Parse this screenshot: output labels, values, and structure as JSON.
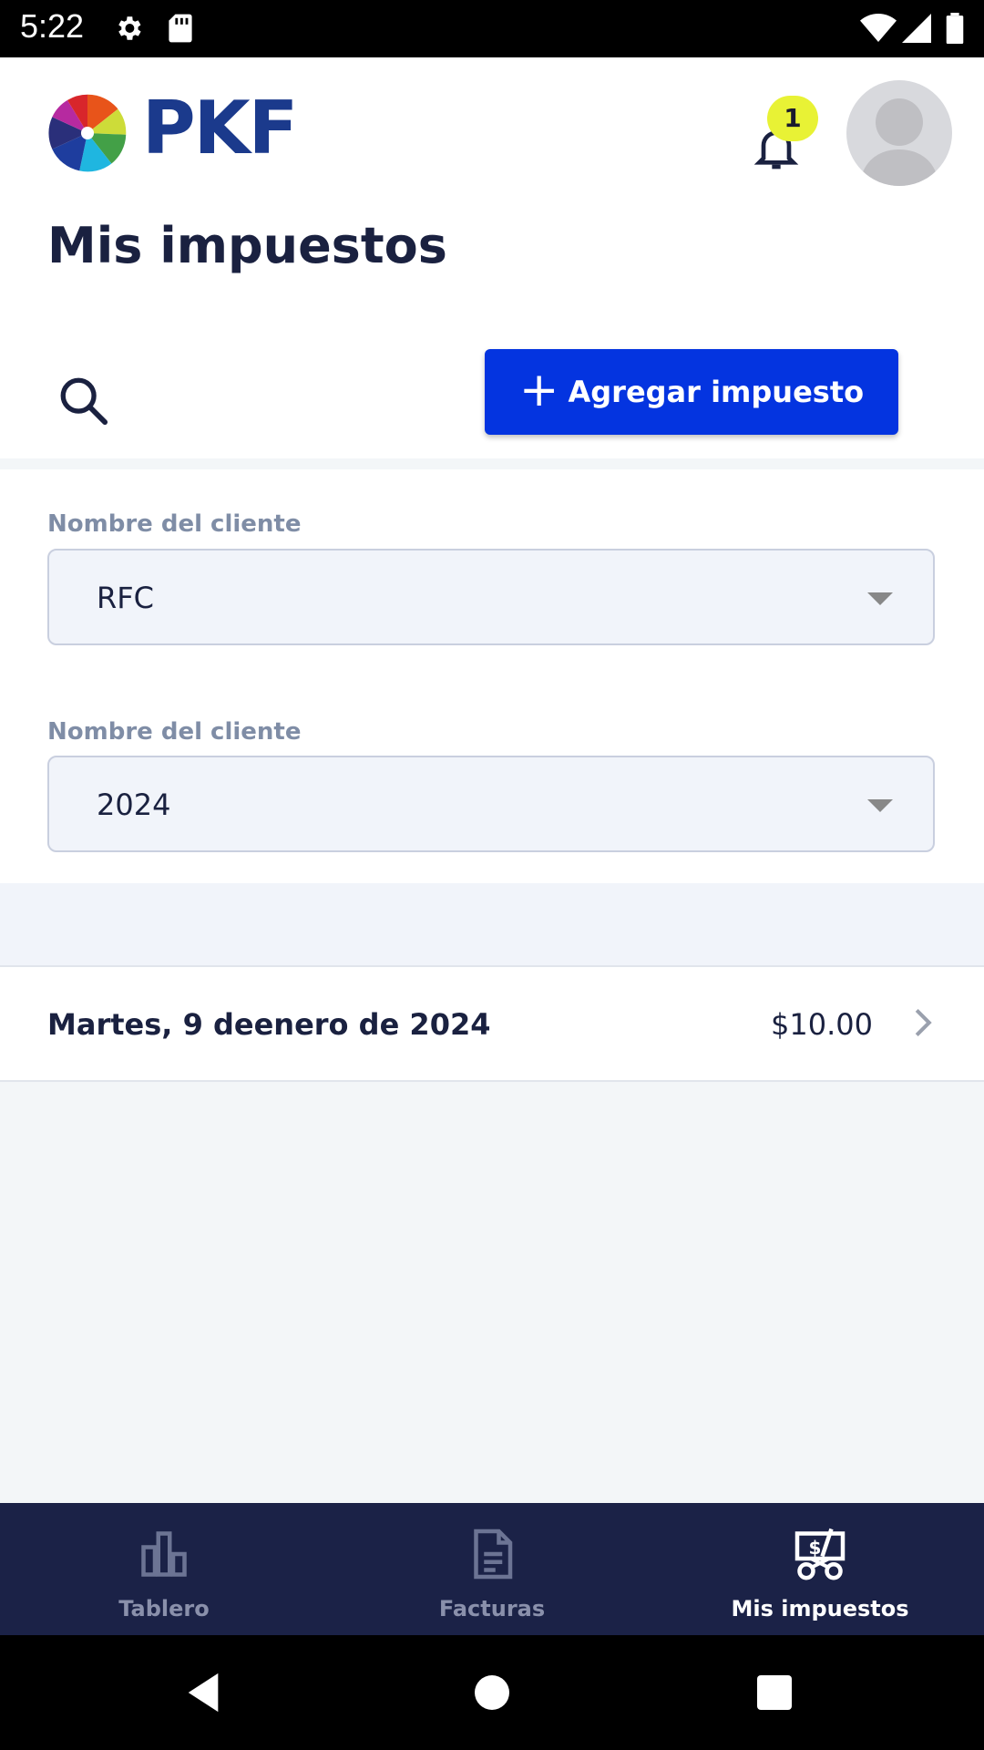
{
  "status_bar": {
    "time": "5:22"
  },
  "header": {
    "logo_text": "PKF",
    "notification_count": "1",
    "page_title": "Mis impuestos"
  },
  "toolbar": {
    "add_label": "Agregar impuesto"
  },
  "filters": [
    {
      "label": "Nombre del cliente",
      "value": "RFC"
    },
    {
      "label": "Nombre del cliente",
      "value": "2024"
    }
  ],
  "records": [
    {
      "date": "Martes, 9 deenero de 2024",
      "amount": "$10.00"
    }
  ],
  "bottom_nav": [
    {
      "label": "Tablero",
      "icon": "bar-chart-icon",
      "active": false
    },
    {
      "label": "Facturas",
      "icon": "document-icon",
      "active": false
    },
    {
      "label": "Mis impuestos",
      "icon": "tax-cart-icon",
      "active": true
    }
  ],
  "colors": {
    "primary": "#0434e0",
    "nav_bg": "#1b2247",
    "badge": "#e8f235",
    "title": "#1a2140",
    "label": "#7f8da6"
  }
}
